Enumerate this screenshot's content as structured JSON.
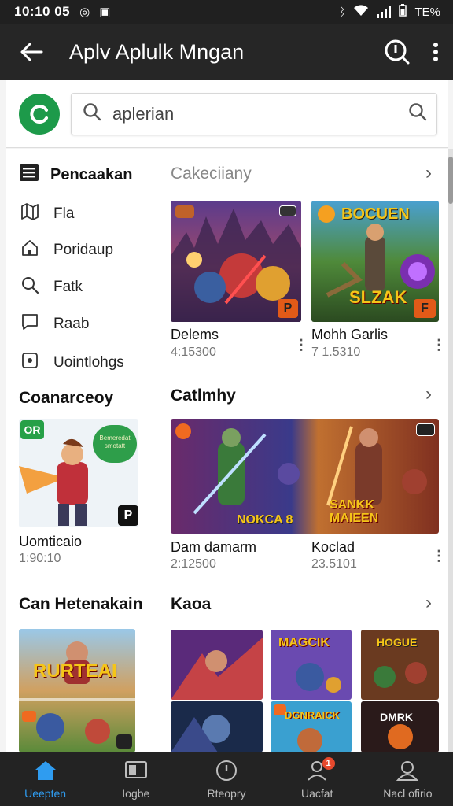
{
  "status": {
    "time": "10:10 05",
    "battery": "TE%"
  },
  "appbar": {
    "title": "Aplv Aplulk Mngan"
  },
  "search": {
    "query": "aplerian"
  },
  "sidebar": {
    "header": "Pencaakan",
    "items": [
      {
        "label": "Fla",
        "icon": "map-icon"
      },
      {
        "label": "Poridaup",
        "icon": "house-icon"
      },
      {
        "label": "Fatk",
        "icon": "search-icon"
      },
      {
        "label": "Raab",
        "icon": "message-icon"
      },
      {
        "label": "Uointlohgs",
        "icon": "square-icon"
      }
    ]
  },
  "section1": {
    "title": "Cakeciiany",
    "cards": [
      {
        "name": "Delems",
        "meta": "4:15300",
        "badge": "P",
        "art": "purple"
      },
      {
        "name": "Mohh Garlis",
        "meta": "7 1.5310",
        "badge": "F",
        "overlay_top": "BOCUEN",
        "overlay_bottom": "SLZAK",
        "art": "green"
      }
    ]
  },
  "section2": {
    "left_title": "Coanarceoy",
    "left_card": {
      "name": "Uomticaio",
      "meta": "1:90:10",
      "badge": "P",
      "tag": "OR",
      "bubble": "Bemeredat smotatt"
    },
    "title": "Catlmhy",
    "banner_left_text": "NOKCA 8",
    "banner_right_text": "SANKK MAIEEN",
    "cards": [
      {
        "name": "Dam damarm",
        "meta": "2:12500"
      },
      {
        "name": "Koclad",
        "meta": "23.5101"
      }
    ]
  },
  "section3": {
    "left_title": "Can Hetenakain",
    "left_card_text": "RURTEAI",
    "title": "Kaoa",
    "tiles": [
      "",
      "MAGCIK",
      "HOGUE",
      "",
      "DGNRAICK",
      "DMRK"
    ]
  },
  "bottomnav": {
    "items": [
      {
        "label": "Ueepten",
        "icon": "home-icon",
        "active": true
      },
      {
        "label": "Iogbe",
        "icon": "apps-icon"
      },
      {
        "label": "Rteopry",
        "icon": "clock-icon"
      },
      {
        "label": "Uacfat",
        "icon": "profile-icon",
        "badge": "1"
      },
      {
        "label": "Nacl ofirio",
        "icon": "user-icon"
      }
    ]
  },
  "colors": {
    "accent": "#2f9cf0",
    "logo": "#1d9a4a",
    "dark_bar": "#262626"
  }
}
